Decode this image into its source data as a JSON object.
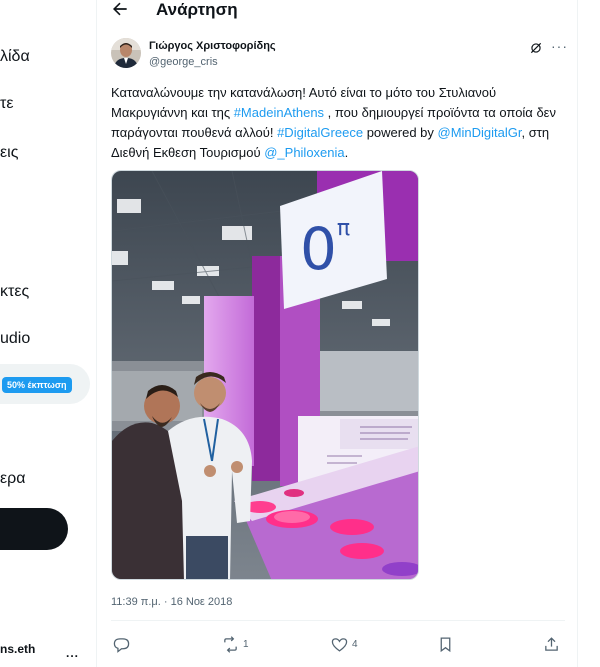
{
  "sidebar": {
    "items": [
      {
        "label": "λίδα"
      },
      {
        "label": "τε"
      },
      {
        "label": "εις"
      },
      {
        "label": "κτες"
      },
      {
        "label": "udio"
      },
      {
        "label": "ερα"
      }
    ],
    "premium_badge": "50% έκπτωση",
    "account_name": "ns.eth",
    "account_more": "..."
  },
  "header": {
    "title": "Ανάρτηση",
    "back_icon": "arrow-left-icon"
  },
  "tweet": {
    "author_name": "Γιώργος Χριστοφορίδης",
    "author_handle": "@george_cris",
    "text_parts": [
      "Καταναλώνουμε την κατανάλωση! Αυτό είναι το μότο του Στυλιανού Μακρυγιάννη και της ",
      "#MadeinAthens",
      " , που δημιουργεί προϊόντα τα οποία δεν παράγονται πουθενά αλλού! ",
      "#DigitalGreece",
      " powered by ",
      "@MinDigitalGr",
      ", στη Διεθνή Εκθεση Τουρισμού ",
      "@_Philoxenia",
      "."
    ],
    "photo_sign_text": "0π",
    "timestamp": "11:39 π.μ. · 16 Νοε 2018",
    "actions": {
      "reply_count": "",
      "retweet_count": "1",
      "like_count": "4"
    }
  },
  "colors": {
    "accent": "#1d9bf0",
    "text_primary": "#0f1419",
    "text_secondary": "#536471"
  }
}
